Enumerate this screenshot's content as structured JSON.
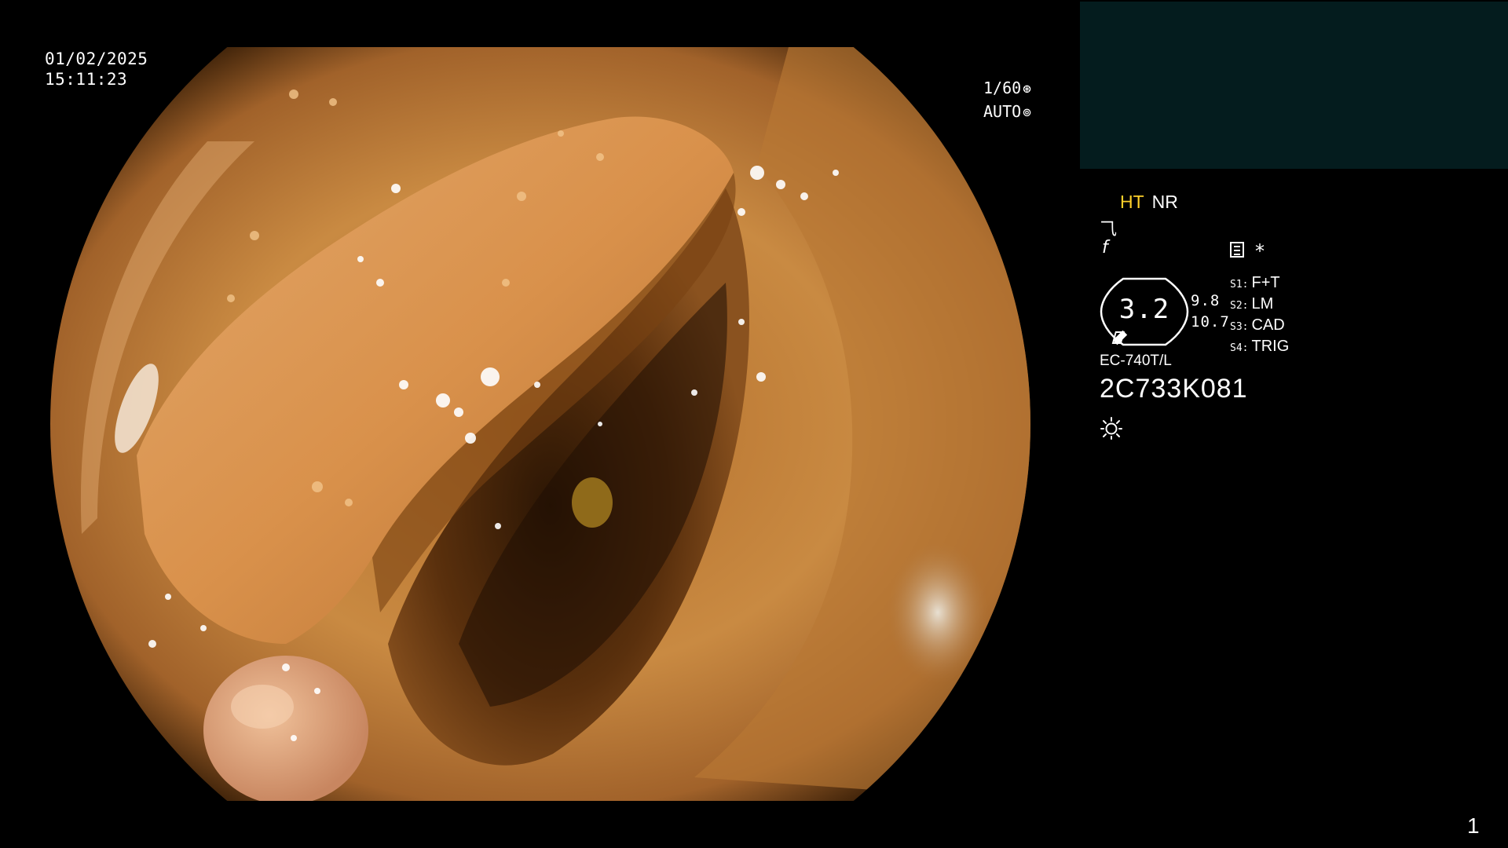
{
  "overlay": {
    "date": "01/02/2025",
    "time": "15:11:23",
    "shutter": "1/60",
    "shutter_icon": "aperture-icon",
    "exposure": "AUTO",
    "exposure_icon": "iris-icon"
  },
  "panel": {
    "mode_ht": "HT",
    "mode_nr": "NR",
    "mode_ht_color": "#ffd02a",
    "glyph_1": "⺄",
    "glyph_2": "f",
    "list_icon": "list-icon",
    "asterisk": "*",
    "gauge_value": "3.2",
    "gauge_icon": "scope-gauge-icon",
    "side_top": "9.8",
    "side_bottom": "10.7",
    "settings": [
      {
        "key": "S1:",
        "value": "F+T"
      },
      {
        "key": "S2:",
        "value": "LM"
      },
      {
        "key": "S3:",
        "value": "CAD"
      },
      {
        "key": "S4:",
        "value": "TRIG"
      }
    ],
    "model": "EC-740T/L",
    "serial": "2C733K081",
    "light_icon": "light-sun-icon"
  },
  "page_number": "1",
  "colors": {
    "background": "#000000",
    "reference_window": "#041c1e",
    "accent_yellow": "#ffd02a"
  }
}
